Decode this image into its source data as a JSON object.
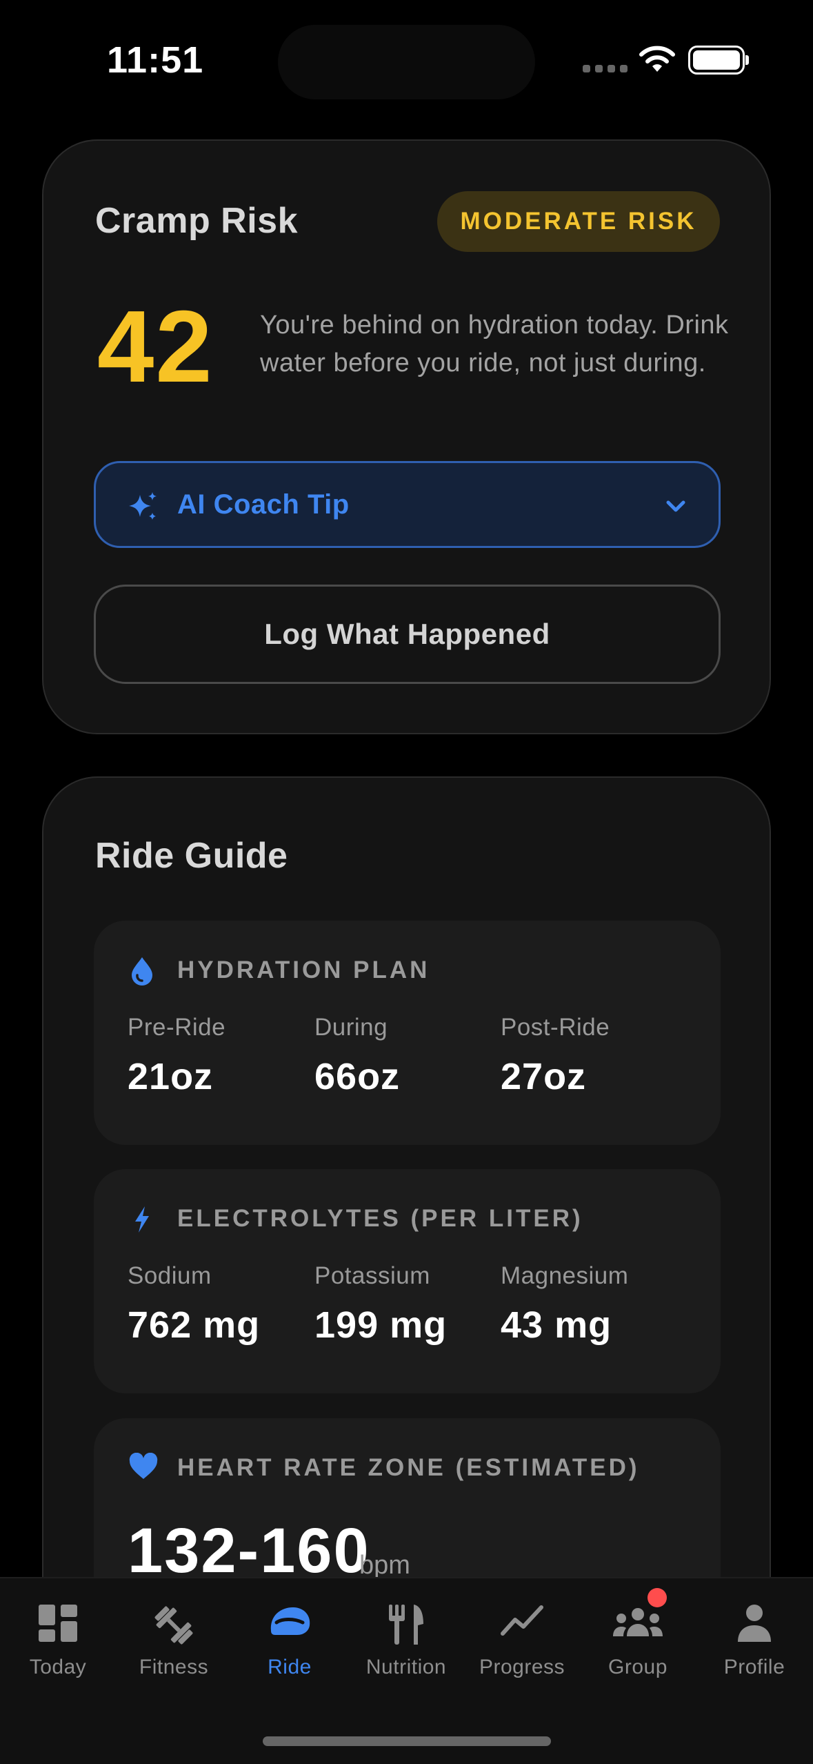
{
  "status_bar": {
    "time": "11:51"
  },
  "cramp_risk": {
    "title": "Cramp Risk",
    "badge": "MODERATE RISK",
    "score": "42",
    "message": "You're behind on hydration today. Drink water before you ride, not just during.",
    "coach_tip_label": "AI Coach Tip",
    "log_button": "Log What Happened",
    "colors": {
      "score": "#f7c325",
      "badge_bg": "#3b3214",
      "accent": "#3f86f0"
    }
  },
  "ride_guide": {
    "title": "Ride Guide",
    "hydration": {
      "title": "HYDRATION PLAN",
      "icon": "water-drop-icon",
      "metrics": [
        {
          "label": "Pre-Ride",
          "value": "21oz"
        },
        {
          "label": "During",
          "value": "66oz"
        },
        {
          "label": "Post-Ride",
          "value": "27oz"
        }
      ]
    },
    "electrolytes": {
      "title": "ELECTROLYTES (PER LITER)",
      "icon": "lightning-bolt-icon",
      "metrics": [
        {
          "label": "Sodium",
          "value": "762 mg"
        },
        {
          "label": "Potassium",
          "value": "199 mg"
        },
        {
          "label": "Magnesium",
          "value": "43 mg"
        }
      ]
    },
    "heart_rate": {
      "title": "HEART RATE ZONE (ESTIMATED)",
      "icon": "heart-icon",
      "value": "132-160",
      "unit": "bpm"
    }
  },
  "tab_bar": {
    "active": "Ride",
    "tabs": [
      {
        "label": "Today",
        "icon": "dashboard-icon"
      },
      {
        "label": "Fitness",
        "icon": "dumbbell-icon"
      },
      {
        "label": "Ride",
        "icon": "helmet-icon"
      },
      {
        "label": "Nutrition",
        "icon": "fork-knife-icon"
      },
      {
        "label": "Progress",
        "icon": "trend-line-icon"
      },
      {
        "label": "Group",
        "icon": "group-icon"
      },
      {
        "label": "Profile",
        "icon": "person-icon"
      }
    ]
  }
}
